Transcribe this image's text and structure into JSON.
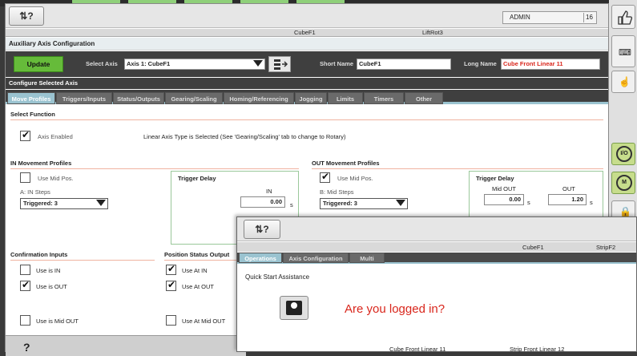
{
  "toolbar": {
    "menu_glyph": "⇅?",
    "user": "ADMIN",
    "user_num": "16"
  },
  "cube_header": {
    "col1": "CubeF1",
    "col2": "LiftRot3"
  },
  "title": "Auxiliary Axis Configuration",
  "controls": {
    "update_label": "Update",
    "select_axis_label": "Select Axis",
    "select_axis_value": "Axis 1: CubeF1",
    "short_name_label": "Short Name",
    "short_name_value": "CubeF1",
    "long_name_label": "Long Name",
    "long_name_value": "Cube Front Linear 11"
  },
  "configure_label": "Configure Selected Axis",
  "tabs": [
    "Move Profiles",
    "Triggers/Inputs",
    "Status/Outputs",
    "Gearing/Scaling",
    "Homing/Referencing",
    "Jogging",
    "Limits",
    "Timers",
    "Other"
  ],
  "select_function": {
    "heading": "Select Function",
    "axis_enabled": "Axis Enabled",
    "info": "Linear Axis Type is Selected (See 'Gearing/Scaling' tab to change to Rotary)"
  },
  "in_profiles": {
    "heading": "IN Movement Profiles",
    "use_mid": "Use Mid Pos.",
    "steps": "A: IN Steps",
    "triggered": "Triggered: 3",
    "trigger_delay": "Trigger Delay",
    "in_label": "IN",
    "in_value": "0.00",
    "unit": "s"
  },
  "out_profiles": {
    "heading": "OUT Movement Profiles",
    "use_mid": "Use Mid Pos.",
    "steps": "B: Mid Steps",
    "triggered": "Triggered: 3",
    "trigger_delay": "Trigger Delay",
    "mid_out_label": "Mid OUT",
    "mid_out_value": "0.00",
    "out_label": "OUT",
    "out_value": "1.20",
    "unit": "s"
  },
  "confirmation": {
    "heading": "Confirmation Inputs",
    "use_in": "Use is IN",
    "use_out": "Use is OUT",
    "use_mid": "Use is Mid OUT"
  },
  "position_status": {
    "heading": "Position Status Output",
    "use_at_in": "Use At IN",
    "use_at_out": "Use At OUT",
    "use_at_mid": "Use At Mid OUT"
  },
  "right_panel": {
    "io": "I/O",
    "m": "M"
  },
  "win2": {
    "menu_glyph": "⇅?",
    "cube1": "CubeF1",
    "cube2": "StripF2",
    "tabs": [
      "Operations",
      "Axis Configuration",
      "Multi"
    ],
    "quick_start": "Quick Start Assistance",
    "logged_in": "Are you logged in?",
    "name1": "Cube Front Linear 11",
    "name2": "Strip Front Linear 12"
  },
  "bottom": {
    "glyph": "?"
  },
  "colors": {
    "accent_green": "#66bb3a",
    "tab_blue": "#9ac3d0",
    "alert_red": "#d9261c"
  }
}
